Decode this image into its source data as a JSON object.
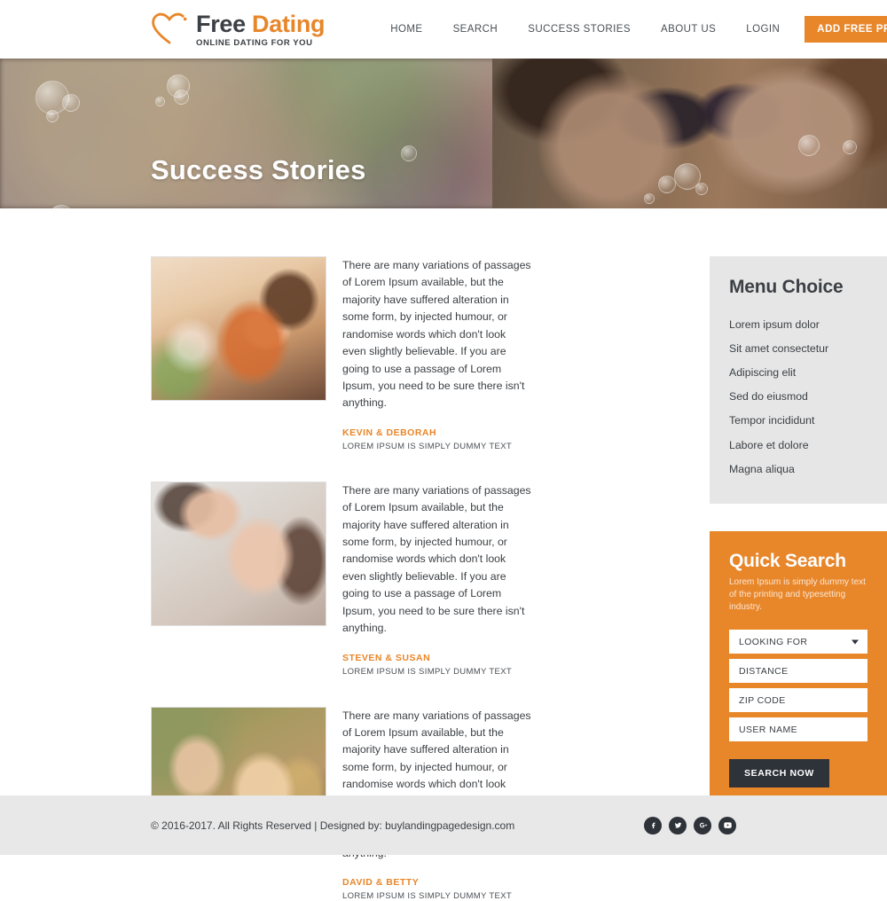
{
  "header": {
    "logo": {
      "icon": "heart-outline-icon",
      "title_part1": "Free",
      "title_part2": "Dating",
      "tagline": "ONLINE DATING FOR YOU"
    },
    "nav": [
      {
        "label": "HOME",
        "name": "home"
      },
      {
        "label": "SEARCH",
        "name": "search"
      },
      {
        "label": "SUCCESS STORIES",
        "name": "success-stories"
      },
      {
        "label": "ABOUT US",
        "name": "about-us"
      },
      {
        "label": "LOGIN",
        "name": "login"
      }
    ],
    "cta_label": "ADD FREE PROFILE"
  },
  "hero": {
    "title": "Success Stories"
  },
  "stories": [
    {
      "text": "There are many variations of passages of Lorem Ipsum available, but the majority have suffered alteration in some form, by injected humour, or randomise words which don't look even slightly believable. If you are going to use a passage of Lorem Ipsum, you need to be sure there isn't anything.",
      "author": "KEVIN & DEBORAH",
      "subtitle": "LOREM IPSUM IS SIMPLY DUMMY TEXT",
      "photo": "couple-sunset-photo"
    },
    {
      "text": "There are many variations of passages of Lorem Ipsum available, but the majority have suffered alteration in some form, by injected humour, or randomise words which don't look even slightly believable. If you are going to use a passage of Lorem Ipsum, you need to be sure there isn't anything.",
      "author": "STEVEN & SUSAN",
      "subtitle": "LOREM IPSUM IS SIMPLY DUMMY TEXT",
      "photo": "couple-embrace-photo"
    },
    {
      "text": "There are many variations of passages of Lorem Ipsum available, but the majority have suffered alteration in some form, by injected humour, or randomise words which don't look even slightly believable. If you are going to use a passage of Lorem Ipsum, you need to be sure there isn't anything.",
      "author": "DAVID & BETTY",
      "subtitle": "LOREM IPSUM IS SIMPLY DUMMY TEXT",
      "photo": "couple-outdoor-photo"
    }
  ],
  "menu_choice": {
    "title": "Menu Choice",
    "items": [
      "Lorem ipsum dolor",
      "Sit amet consectetur",
      "Adipiscing elit",
      "Sed do eiusmod",
      "Tempor incididunt",
      "Labore et dolore",
      "Magna aliqua"
    ]
  },
  "quick_search": {
    "title": "Quick Search",
    "description": "Lorem Ipsum is simply dummy text of the printing and typesetting industry.",
    "fields": [
      {
        "label": "LOOKING FOR",
        "type": "select",
        "name": "looking-for"
      },
      {
        "label": "DISTANCE",
        "type": "text",
        "name": "distance"
      },
      {
        "label": "ZIP CODE",
        "type": "text",
        "name": "zip-code"
      },
      {
        "label": "USER NAME",
        "type": "text",
        "name": "user-name"
      }
    ],
    "button_label": "SEARCH NOW"
  },
  "footer": {
    "text": "© 2016-2017. All Rights Reserved  |  Designed by: buylandingpagedesign.com",
    "socials": [
      {
        "name": "facebook-icon"
      },
      {
        "name": "twitter-icon"
      },
      {
        "name": "google-plus-icon"
      },
      {
        "name": "youtube-icon"
      }
    ]
  },
  "colors": {
    "accent": "#e8862a",
    "dark": "#2e3239",
    "text": "#3c4044",
    "card_bg": "#e6e6e6",
    "footer_bg": "#e8e8e8"
  }
}
